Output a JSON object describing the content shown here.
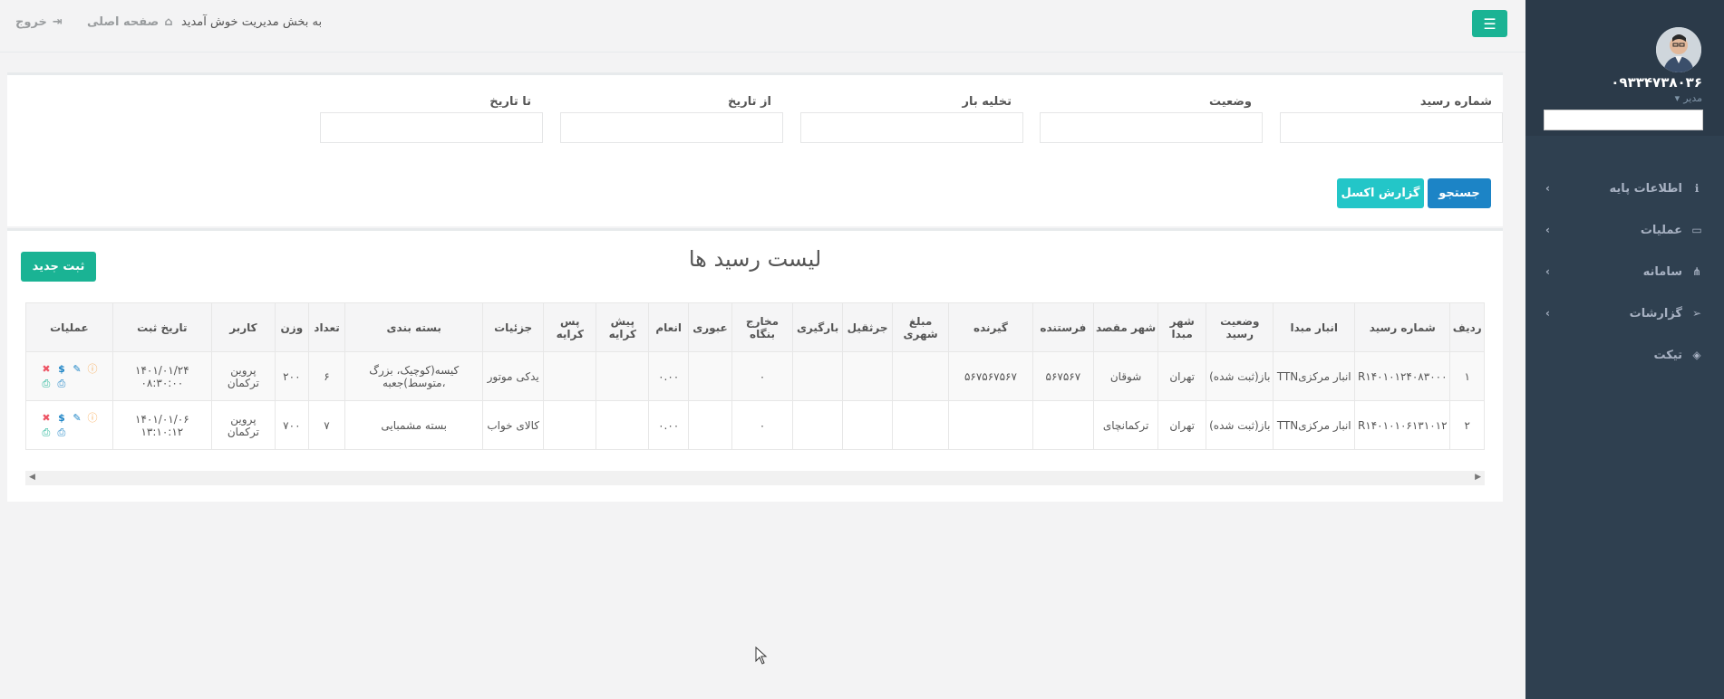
{
  "topbar": {
    "welcome": "به بخش مدیریت خوش آمدید",
    "home": "صفحه اصلی",
    "logout": "خروج",
    "menu_icon": "bars-icon"
  },
  "sidebar": {
    "user_name": "۰۹۳۳۴۷۳۸۰۳۶",
    "role": "مدیر",
    "items": [
      {
        "label": "اطلاعات پایه",
        "icon": "info-icon"
      },
      {
        "label": "عملیات",
        "icon": "inbox-icon"
      },
      {
        "label": "سامانه",
        "icon": "sitemap-icon"
      },
      {
        "label": "گزارشات",
        "icon": "paper-plane-icon"
      },
      {
        "label": "تیکت",
        "icon": "tag-icon"
      }
    ]
  },
  "filter": {
    "receipt_no": "شماره رسید",
    "status": "وضعیت",
    "unload": "تخلیه بار",
    "from_date": "از تاریخ",
    "to_date": "تا تاریخ",
    "search_btn": "جستجو",
    "excel_btn": "گزارش اکسل"
  },
  "list": {
    "title": "لیست رسید ها",
    "new_btn": "ثبت جدید",
    "headers": [
      "ردیف",
      "شماره رسید",
      "انبار مبدا",
      "وضعیت رسید",
      "شهر مبدا",
      "شهر مقصد",
      "فرستنده",
      "گیرنده",
      "مبلغ شهری",
      "جرثقیل",
      "بارگیری",
      "مخارج بنگاه",
      "عبوری",
      "انعام",
      "پیش کرایه",
      "پس کرایه",
      "جزئیات",
      "بسته بندی",
      "تعداد",
      "وزن",
      "کاربر",
      "تاریخ ثبت",
      "عملیات"
    ],
    "rows": [
      {
        "row": "۱",
        "receipt": "R۱۴۰۱۰۱۲۴۰۸۳۰۰۰",
        "warehouse": "انبار مرکزیTTN",
        "status": "باز(ثبت شده)",
        "origin": "تهران",
        "dest": "شوقان",
        "sender": "۵۶۷۵۶۷",
        "receiver": "۵۶۷۵۶۷۵۶۷",
        "city_amount": "",
        "crane": "",
        "loading": "",
        "agency": "۰",
        "transit": "",
        "tip": "۰.۰۰",
        "prepay": "",
        "postpay": "",
        "details": "یدکی موتور",
        "packaging": "کیسه(کوچیک، بزرگ ،متوسط)جعبه",
        "count": "۶",
        "weight": "۲۰۰",
        "user": "پروین ترکمان",
        "date": "۱۴۰۱/۰۱/۲۴ ۰۸:۳۰:۰۰"
      },
      {
        "row": "۲",
        "receipt": "R۱۴۰۱۰۱۰۶۱۳۱۰۱۲",
        "warehouse": "انبار مرکزیTTN",
        "status": "باز(ثبت شده)",
        "origin": "تهران",
        "dest": "ترکمانچای",
        "sender": "",
        "receiver": "",
        "city_amount": "",
        "crane": "",
        "loading": "",
        "agency": "۰",
        "transit": "",
        "tip": "۰.۰۰",
        "prepay": "",
        "postpay": "",
        "details": "کالای خواب",
        "packaging": "بسته مشمبایی",
        "count": "۷",
        "weight": "۷۰۰",
        "user": "پروین ترکمان",
        "date": "۱۴۰۱/۰۱/۰۶ ۱۳:۱۰:۱۲"
      }
    ],
    "ops_icons": [
      "info-icon",
      "edit-icon",
      "dollar-icon",
      "delete-icon",
      "print-icon",
      "print-green-icon"
    ]
  }
}
